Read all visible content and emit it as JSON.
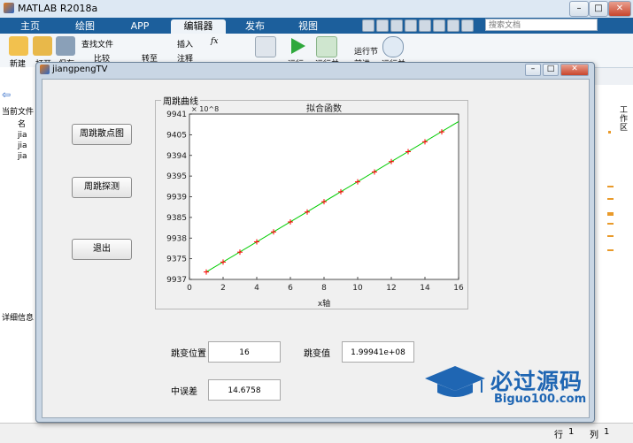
{
  "app": {
    "title": "MATLAB R2018a"
  },
  "window_buttons": [
    "–",
    "□",
    "✕"
  ],
  "tabs": [
    "主页",
    "绘图",
    "APP",
    "编辑器",
    "发布",
    "视图"
  ],
  "search": {
    "placeholder": "搜索文档"
  },
  "ribbon": {
    "new_label": "新建",
    "open_label": "打开",
    "save_label": "保存",
    "find_files_label": "查找文件",
    "compare_label": "比较",
    "goto_label": "转至",
    "insert_label": "插入",
    "comment_label": "注释",
    "breakpoints_label": "断点",
    "run_label": "运行",
    "run_advance_label": "运行并",
    "run_section_label": "运行节",
    "advance_label": "前进",
    "run_time_label": "运行并"
  },
  "left_panel": {
    "current_folder_label": "当前文件",
    "files": [
      "名",
      "jia",
      "jia",
      "jia"
    ],
    "details_label": "详细信息"
  },
  "right_panel": {
    "workspace_label": "工作区"
  },
  "statusbar": {
    "row_label": "行",
    "row_value": "1",
    "col_label": "列",
    "col_value": "1"
  },
  "figure": {
    "title": "jiangpengTV",
    "buttons": {
      "scatter": "周跳散点图",
      "detect": "周跳探测",
      "exit": "退出"
    },
    "panel_title": "周跳曲线",
    "fields": {
      "position_label": "跳变位置",
      "position_value": "16",
      "jump_label": "跳变值",
      "jump_value": "1.99941e+08",
      "error_label": "中误差",
      "error_value": "14.6758"
    }
  },
  "chart_data": {
    "type": "line",
    "title": "拟合函数",
    "xlabel": "x轴",
    "ylabel": "",
    "exponent_label": "× 10^8",
    "xlim": [
      0,
      16
    ],
    "ylim": [
      9937,
      9941
    ],
    "x_ticks": [
      "0",
      "2",
      "4",
      "6",
      "8",
      "10",
      "12",
      "14",
      "16"
    ],
    "y_ticks": [
      "9937",
      "9375",
      "9938",
      "9385",
      "9939",
      "9395",
      "9394",
      "9405",
      "9941"
    ],
    "series": [
      {
        "kind": "fit-line",
        "color": "#00cc00",
        "x": [
          1,
          16
        ],
        "y": [
          9937.18,
          9940.82
        ]
      },
      {
        "kind": "points",
        "marker": "+",
        "color": "#ff0000",
        "x": [
          1,
          2,
          3,
          4,
          5,
          6,
          7,
          8,
          9,
          10,
          11,
          12,
          13,
          14,
          15
        ],
        "y": [
          9937.18,
          9937.42,
          9937.66,
          9937.91,
          9938.15,
          9938.39,
          9938.63,
          9938.88,
          9939.12,
          9939.36,
          9939.6,
          9939.85,
          9940.09,
          9940.33,
          9940.57
        ]
      }
    ]
  },
  "watermark": {
    "brand": "必过源码",
    "site": "Biguo100.com"
  }
}
